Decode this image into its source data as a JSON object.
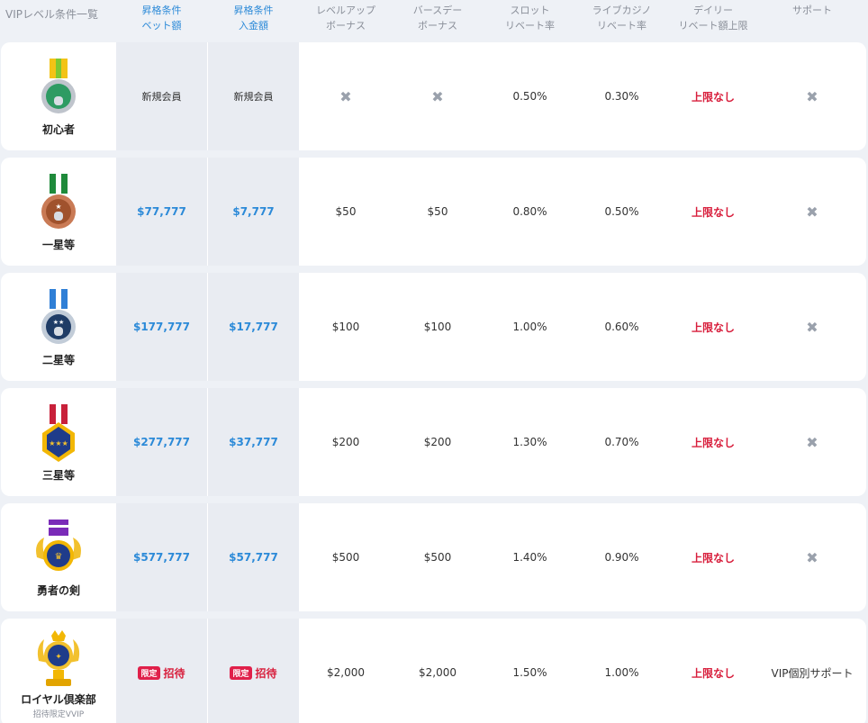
{
  "headers": [
    "VIPレベル条件一覧",
    "昇格条件\nベット額",
    "昇格条件\n入金額",
    "レベルアップ\nボーナス",
    "バースデー\nボーナス",
    "スロット\nリベート率",
    "ライブカジノ\nリベート率",
    "デイリー\nリベート額上限",
    "サポート"
  ],
  "header_lines": [
    [
      "VIPレベル条件一覧"
    ],
    [
      "昇格条件",
      "ベット額"
    ],
    [
      "昇格条件",
      "入金額"
    ],
    [
      "レベルアップ",
      "ボーナス"
    ],
    [
      "バースデー",
      "ボーナス"
    ],
    [
      "スロット",
      "リベート率"
    ],
    [
      "ライブカジノ",
      "リベート率"
    ],
    [
      "デイリー",
      "リベート額上限"
    ],
    [
      "サポート"
    ]
  ],
  "cross_symbol": "✖",
  "badge_label": "限定",
  "invite_label": "招待",
  "rows": [
    {
      "name": "初心者",
      "sub": "",
      "bet": "新規会員",
      "deposit": "新規会員",
      "levelup": "✖",
      "birthday": "✖",
      "slot": "0.50%",
      "live": "0.30%",
      "daily": "上限なし",
      "support": "✖",
      "medal": "beginner-medal-icon"
    },
    {
      "name": "一星等",
      "sub": "",
      "bet": "$77,777",
      "deposit": "$7,777",
      "levelup": "$50",
      "birthday": "$50",
      "slot": "0.80%",
      "live": "0.50%",
      "daily": "上限なし",
      "support": "✖",
      "medal": "one-star-medal-icon"
    },
    {
      "name": "二星等",
      "sub": "",
      "bet": "$177,777",
      "deposit": "$17,777",
      "levelup": "$100",
      "birthday": "$100",
      "slot": "1.00%",
      "live": "0.60%",
      "daily": "上限なし",
      "support": "✖",
      "medal": "two-star-medal-icon"
    },
    {
      "name": "三星等",
      "sub": "",
      "bet": "$277,777",
      "deposit": "$37,777",
      "levelup": "$200",
      "birthday": "$200",
      "slot": "1.30%",
      "live": "0.70%",
      "daily": "上限なし",
      "support": "✖",
      "medal": "three-star-medal-icon"
    },
    {
      "name": "勇者の剣",
      "sub": "",
      "bet": "$577,777",
      "deposit": "$57,777",
      "levelup": "$500",
      "birthday": "$500",
      "slot": "1.40%",
      "live": "0.90%",
      "daily": "上限なし",
      "support": "✖",
      "medal": "hero-sword-medal-icon"
    },
    {
      "name": "ロイヤル倶楽部",
      "sub": "招待限定VVIP",
      "bet": "招待",
      "deposit": "招待",
      "levelup": "$2,000",
      "birthday": "$2,000",
      "slot": "1.50%",
      "live": "1.00%",
      "daily": "上限なし",
      "support": "VIP個別サポート",
      "medal": "royal-club-trophy-icon"
    }
  ],
  "colors": {
    "accent_blue": "#2c8ad8",
    "accent_red": "#d81e3c",
    "badge_red": "#e0204a",
    "cross_grey": "#9aa1ac",
    "grey_column": "#e9ecf2",
    "page_bg": "#eef1f6"
  }
}
